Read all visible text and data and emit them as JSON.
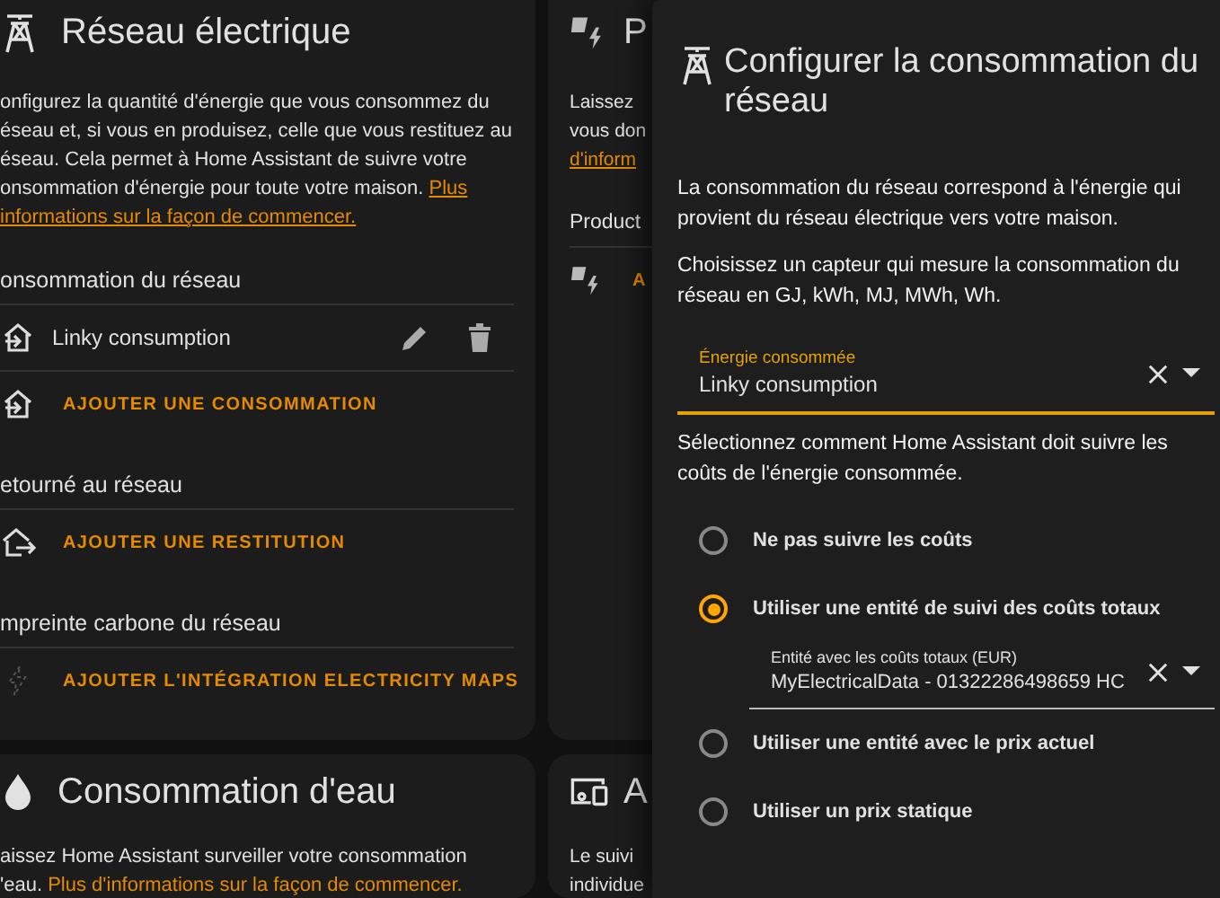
{
  "grid_card": {
    "title": "Réseau électrique",
    "description": [
      [
        {
          "kind": "text",
          "text": "onfigurez la quantité d'énergie que vous consommez du"
        }
      ],
      [
        {
          "kind": "text",
          "text": "éseau et, si vous en produisez, celle que vous restituez au"
        }
      ],
      [
        {
          "kind": "text",
          "text": "éseau. Cela permet à Home Assistant de suivre votre"
        }
      ],
      [
        {
          "kind": "text",
          "text": "onsommation d'énergie pour toute votre maison. "
        },
        {
          "kind": "link",
          "text": "Plus"
        }
      ],
      [
        {
          "kind": "link",
          "text": "informations sur la façon de commencer."
        }
      ]
    ],
    "sections": [
      {
        "heading": "onsommation du réseau",
        "items": [
          {
            "kind": "source",
            "label": "Linky consumption"
          },
          {
            "kind": "add",
            "label": "AJOUTER UNE CONSOMMATION"
          }
        ]
      },
      {
        "heading": "etourné au réseau",
        "items": [
          {
            "kind": "add",
            "label": "AJOUTER UNE RESTITUTION"
          }
        ]
      },
      {
        "heading": "mpreinte carbone du réseau",
        "items": [
          {
            "kind": "add",
            "label": "AJOUTER L'INTÉGRATION ELECTRICITY MAPS"
          }
        ]
      }
    ]
  },
  "water_card": {
    "title": "Consommation d'eau",
    "description": [
      [
        {
          "kind": "text",
          "text": "aissez Home Assistant surveiller votre consommation"
        }
      ],
      [
        {
          "kind": "text",
          "text": "'eau. "
        },
        {
          "kind": "plain_link",
          "text": "Plus d'informations sur la façon de commencer."
        }
      ]
    ]
  },
  "solar_card": {
    "title": "P",
    "description": [
      [
        {
          "kind": "text",
          "text": "Laissez"
        }
      ],
      [
        {
          "kind": "text",
          "text": "vous don"
        }
      ],
      [
        {
          "kind": "link",
          "text": "d'inform"
        }
      ]
    ],
    "sections": [
      {
        "heading": "Product",
        "items": [
          {
            "kind": "add",
            "label": "A"
          }
        ]
      }
    ]
  },
  "devices_card": {
    "title": "A",
    "description": [
      [
        {
          "kind": "text",
          "text": "Le suivi"
        }
      ],
      [
        {
          "kind": "text",
          "text": "individue"
        }
      ]
    ]
  },
  "dialog": {
    "title": "Configurer la consommation du réseau",
    "paragraphs": [
      "La consommation du réseau correspond à l'énergie qui provient du réseau électrique vers votre maison.",
      "Choisissez un capteur qui mesure la consommation du réseau en GJ, kWh, MJ, MWh, Wh."
    ],
    "energy_field": {
      "label": "Énergie consommée",
      "value": "Linky consumption"
    },
    "cost_prompt": "Sélectionnez comment Home Assistant doit suivre les coûts de l'énergie consommée.",
    "cost_options": [
      {
        "label": "Ne pas suivre les coûts",
        "selected": false
      },
      {
        "label": "Utiliser une entité de suivi des coûts totaux",
        "selected": true,
        "field": {
          "label": "Entité avec les coûts totaux (EUR)",
          "value": "MyElectricalData - 01322286498659 HC"
        }
      },
      {
        "label": "Utiliser une entité avec le prix actuel",
        "selected": false
      },
      {
        "label": "Utiliser un prix statique",
        "selected": false
      }
    ]
  }
}
